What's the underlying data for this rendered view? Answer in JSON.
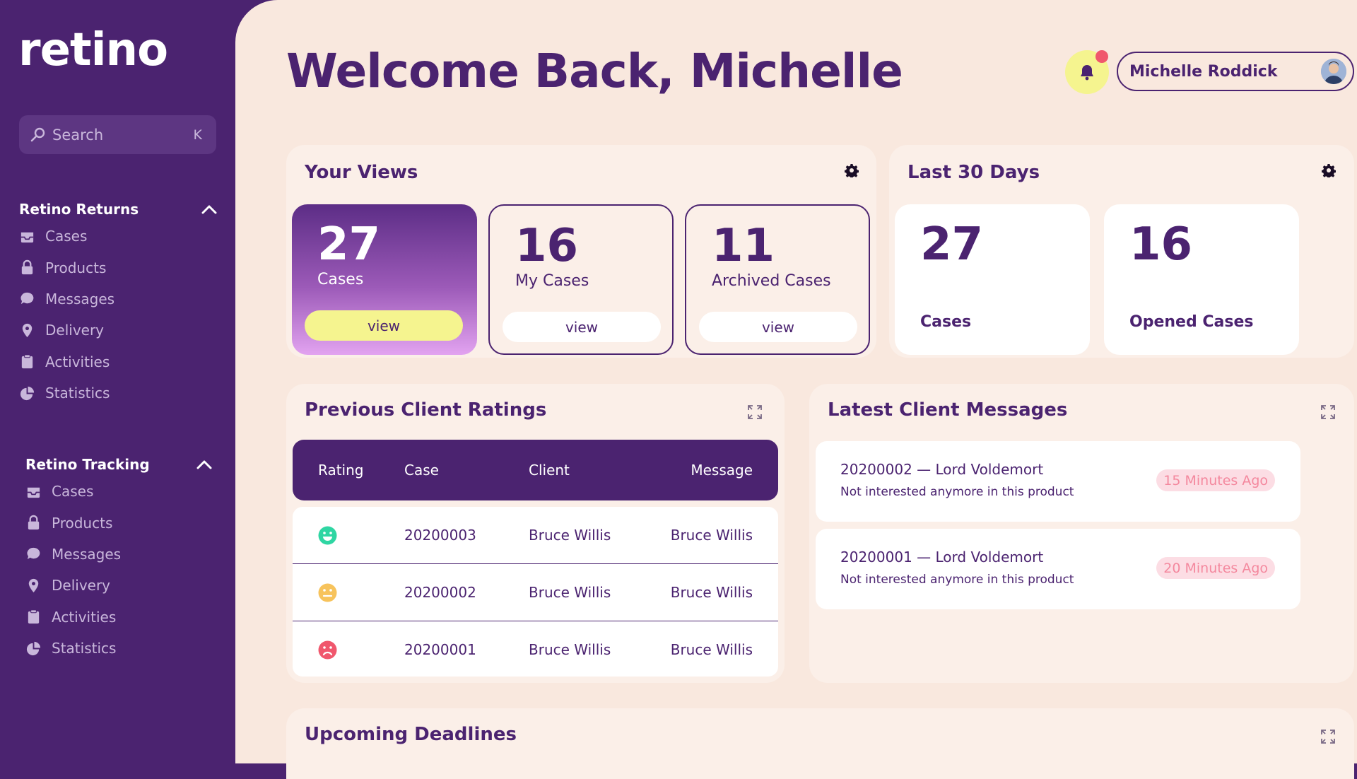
{
  "sidebar": {
    "logo": "retino",
    "search": {
      "placeholder": "Search",
      "shortcut": "K"
    },
    "groups": [
      {
        "title": "Retino Returns",
        "items": [
          {
            "label": "Cases",
            "icon": "inbox-icon"
          },
          {
            "label": "Products",
            "icon": "lock-icon"
          },
          {
            "label": "Messages",
            "icon": "chat-bubble-icon"
          },
          {
            "label": "Delivery",
            "icon": "location-pin-icon"
          },
          {
            "label": "Activities",
            "icon": "clipboard-icon"
          },
          {
            "label": "Statistics",
            "icon": "pie-chart-icon"
          }
        ]
      },
      {
        "title": "Retino Tracking",
        "items": [
          {
            "label": "Cases",
            "icon": "inbox-icon"
          },
          {
            "label": "Products",
            "icon": "lock-icon"
          },
          {
            "label": "Messages",
            "icon": "chat-bubble-icon"
          },
          {
            "label": "Delivery",
            "icon": "location-pin-icon"
          },
          {
            "label": "Activities",
            "icon": "clipboard-icon"
          },
          {
            "label": "Statistics",
            "icon": "pie-chart-icon"
          }
        ]
      }
    ]
  },
  "header": {
    "welcome": "Welcome Back, Michelle",
    "user_name": "Michelle Roddick"
  },
  "your_views": {
    "title": "Your Views",
    "cards": [
      {
        "value": "27",
        "label": "Cases",
        "button": "view"
      },
      {
        "value": "16",
        "label": "My Cases",
        "button": "view"
      },
      {
        "value": "11",
        "label": "Archived Cases",
        "button": "view"
      }
    ]
  },
  "last_30_days": {
    "title": "Last 30 Days",
    "cards": [
      {
        "value": "27",
        "label": "Cases"
      },
      {
        "value": "16",
        "label": "Opened Cases"
      }
    ]
  },
  "ratings": {
    "title": "Previous Client Ratings",
    "columns": [
      "Rating",
      "Case",
      "Client",
      "Message"
    ],
    "rows": [
      {
        "rating": "happy",
        "case": "20200003",
        "client": "Bruce Willis",
        "message": "Bruce Willis"
      },
      {
        "rating": "neutral",
        "case": "20200002",
        "client": "Bruce Willis",
        "message": "Bruce Willis"
      },
      {
        "rating": "sad",
        "case": "20200001",
        "client": "Bruce Willis",
        "message": "Bruce Willis"
      }
    ]
  },
  "messages": {
    "title": "Latest Client Messages",
    "items": [
      {
        "title": "20200002 — Lord Voldemort",
        "text": "Not interested anymore in this product",
        "time": "15 Minutes Ago"
      },
      {
        "title": "20200001 — Lord Voldemort",
        "text": "Not interested anymore in this product",
        "time": "20 Minutes Ago"
      }
    ]
  },
  "deadlines": {
    "title": "Upcoming Deadlines"
  },
  "colors": {
    "primary": "#4b2370",
    "background": "#f9e8de",
    "accent_yellow": "#f5f48f",
    "notification": "#f0576d",
    "happy": "#2fd6a3",
    "neutral": "#f7c35c",
    "sad": "#f0576d"
  }
}
